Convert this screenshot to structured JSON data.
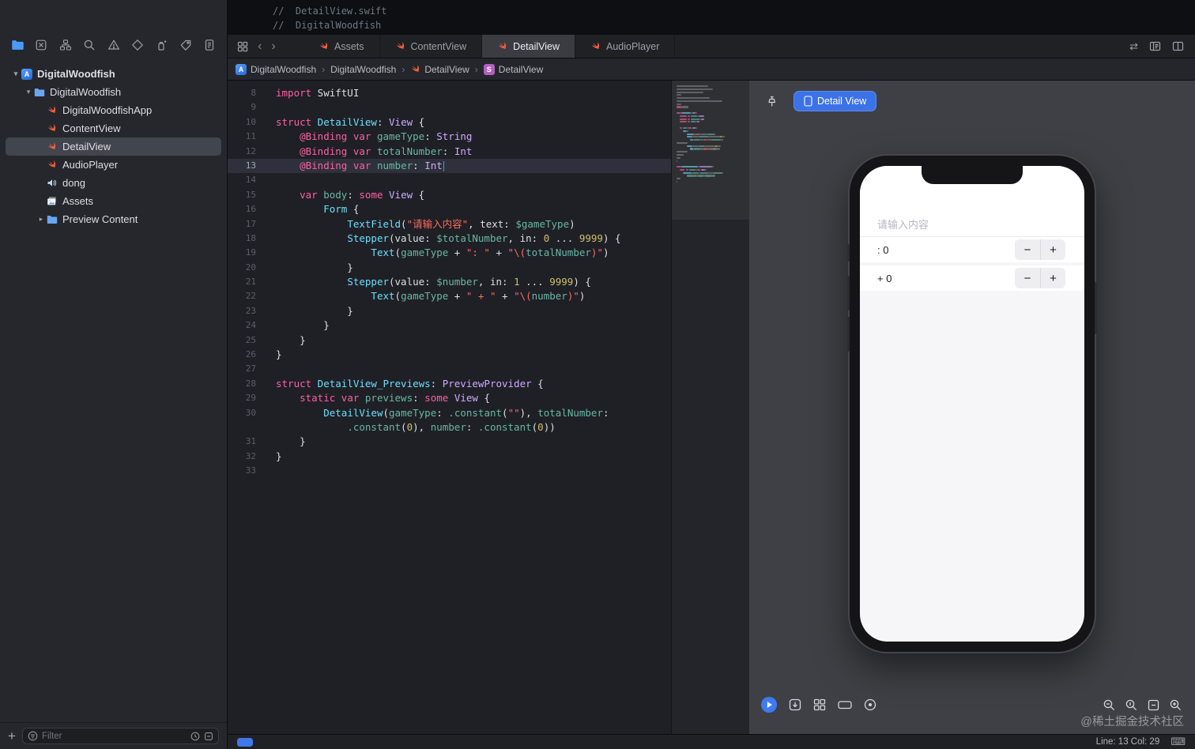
{
  "header_comments": [
    "//  DetailView.swift",
    "//  DigitalWoodfish"
  ],
  "glyphs": {
    "chevron_down": "▾",
    "chevron_right": "▸",
    "back": "‹",
    "forward": "›",
    "crumb_sep": "›",
    "keyboard": "⌨",
    "swap": "⇄"
  },
  "sidebar": {
    "tree": [
      {
        "label": "DigitalWoodfish",
        "icon": "app",
        "level": 0,
        "chevron": "down",
        "bold": true
      },
      {
        "label": "DigitalWoodfish",
        "icon": "folder",
        "level": 1,
        "chevron": "down"
      },
      {
        "label": "DigitalWoodfishApp",
        "icon": "swift",
        "level": 2
      },
      {
        "label": "ContentView",
        "icon": "swift",
        "level": 2
      },
      {
        "label": "DetailView",
        "icon": "swift",
        "level": 2,
        "selected": true
      },
      {
        "label": "AudioPlayer",
        "icon": "swift",
        "level": 2
      },
      {
        "label": "dong",
        "icon": "audio",
        "level": 2
      },
      {
        "label": "Assets",
        "icon": "assets",
        "level": 2
      },
      {
        "label": "Preview Content",
        "icon": "folder",
        "level": 2,
        "chevron": "right"
      }
    ],
    "add_button": "+",
    "filter_placeholder": "Filter"
  },
  "tabs": [
    {
      "label": "Assets"
    },
    {
      "label": "ContentView"
    },
    {
      "label": "DetailView",
      "active": true
    },
    {
      "label": "AudioPlayer"
    }
  ],
  "breadcrumb": [
    {
      "label": "DigitalWoodfish",
      "icon": "app"
    },
    {
      "label": "DigitalWoodfish",
      "icon": "none"
    },
    {
      "label": "DetailView",
      "icon": "swift"
    },
    {
      "label": "DetailView",
      "icon": "sbadge"
    }
  ],
  "editor": {
    "highlight_line": "13",
    "palette": {
      "kw": "#fc5fa3",
      "ty": "#d0a8ff",
      "cy": "#6bdfff",
      "te": "#67b7a4",
      "st": "#fc6a5d",
      "nu": "#d0bf69",
      "pl": "#dfdfe0",
      "cm": "#6c7986"
    },
    "minimap_prefix_widths": [
      40,
      46,
      34,
      6,
      42,
      58,
      6
    ],
    "lines": [
      {
        "n": "8",
        "t": [
          [
            "kw",
            "import"
          ],
          [
            "pl",
            " SwiftUI"
          ]
        ]
      },
      {
        "n": "9",
        "t": []
      },
      {
        "n": "10",
        "t": [
          [
            "kw",
            "struct"
          ],
          [
            "cy",
            " DetailView"
          ],
          [
            "pl",
            ": "
          ],
          [
            "ty",
            "View"
          ],
          [
            "pl",
            " {"
          ]
        ]
      },
      {
        "n": "11",
        "t": [
          [
            "pl",
            "    "
          ],
          [
            "kw",
            "@Binding"
          ],
          [
            "pl",
            " "
          ],
          [
            "kw",
            "var"
          ],
          [
            "pl",
            " "
          ],
          [
            "te",
            "gameType"
          ],
          [
            "pl",
            ": "
          ],
          [
            "ty",
            "String"
          ]
        ]
      },
      {
        "n": "12",
        "t": [
          [
            "pl",
            "    "
          ],
          [
            "kw",
            "@Binding"
          ],
          [
            "pl",
            " "
          ],
          [
            "kw",
            "var"
          ],
          [
            "pl",
            " "
          ],
          [
            "te",
            "totalNumber"
          ],
          [
            "pl",
            ": "
          ],
          [
            "ty",
            "Int"
          ]
        ]
      },
      {
        "n": "13",
        "t": [
          [
            "pl",
            "    "
          ],
          [
            "kw",
            "@Binding"
          ],
          [
            "pl",
            " "
          ],
          [
            "kw",
            "var"
          ],
          [
            "pl",
            " "
          ],
          [
            "te",
            "number"
          ],
          [
            "pl",
            ": "
          ],
          [
            "ty",
            "Int"
          ]
        ]
      },
      {
        "n": "14",
        "t": []
      },
      {
        "n": "15",
        "t": [
          [
            "pl",
            "    "
          ],
          [
            "kw",
            "var"
          ],
          [
            "pl",
            " "
          ],
          [
            "te",
            "body"
          ],
          [
            "pl",
            ": "
          ],
          [
            "kw",
            "some"
          ],
          [
            "pl",
            " "
          ],
          [
            "ty",
            "View"
          ],
          [
            "pl",
            " {"
          ]
        ]
      },
      {
        "n": "16",
        "t": [
          [
            "pl",
            "        "
          ],
          [
            "cy",
            "Form"
          ],
          [
            "pl",
            " {"
          ]
        ]
      },
      {
        "n": "17",
        "t": [
          [
            "pl",
            "            "
          ],
          [
            "cy",
            "TextField"
          ],
          [
            "pl",
            "("
          ],
          [
            "st",
            "\"请输入内容\""
          ],
          [
            "pl",
            ", text: "
          ],
          [
            "te",
            "$gameType"
          ],
          [
            "pl",
            ")"
          ]
        ]
      },
      {
        "n": "18",
        "t": [
          [
            "pl",
            "            "
          ],
          [
            "cy",
            "Stepper"
          ],
          [
            "pl",
            "(value: "
          ],
          [
            "te",
            "$totalNumber"
          ],
          [
            "pl",
            ", in: "
          ],
          [
            "nu",
            "0"
          ],
          [
            "pl",
            " ... "
          ],
          [
            "nu",
            "9999"
          ],
          [
            "pl",
            ") {"
          ]
        ]
      },
      {
        "n": "19",
        "t": [
          [
            "pl",
            "                "
          ],
          [
            "cy",
            "Text"
          ],
          [
            "pl",
            "("
          ],
          [
            "te",
            "gameType"
          ],
          [
            "pl",
            " + "
          ],
          [
            "st",
            "\": \""
          ],
          [
            "pl",
            " + "
          ],
          [
            "st",
            "\"\\("
          ],
          [
            "te",
            "totalNumber"
          ],
          [
            "st",
            ")\""
          ],
          [
            "pl",
            ")"
          ]
        ]
      },
      {
        "n": "20",
        "t": [
          [
            "pl",
            "            }"
          ]
        ]
      },
      {
        "n": "21",
        "t": [
          [
            "pl",
            "            "
          ],
          [
            "cy",
            "Stepper"
          ],
          [
            "pl",
            "(value: "
          ],
          [
            "te",
            "$number"
          ],
          [
            "pl",
            ", in: "
          ],
          [
            "nu",
            "1"
          ],
          [
            "pl",
            " ... "
          ],
          [
            "nu",
            "9999"
          ],
          [
            "pl",
            ") {"
          ]
        ]
      },
      {
        "n": "22",
        "t": [
          [
            "pl",
            "                "
          ],
          [
            "cy",
            "Text"
          ],
          [
            "pl",
            "("
          ],
          [
            "te",
            "gameType"
          ],
          [
            "pl",
            " + "
          ],
          [
            "st",
            "\" + \""
          ],
          [
            "pl",
            " + "
          ],
          [
            "st",
            "\"\\("
          ],
          [
            "te",
            "number"
          ],
          [
            "st",
            ")\""
          ],
          [
            "pl",
            ")"
          ]
        ]
      },
      {
        "n": "23",
        "t": [
          [
            "pl",
            "            }"
          ]
        ]
      },
      {
        "n": "24",
        "t": [
          [
            "pl",
            "        }"
          ]
        ]
      },
      {
        "n": "25",
        "t": [
          [
            "pl",
            "    }"
          ]
        ]
      },
      {
        "n": "26",
        "t": [
          [
            "pl",
            "}"
          ]
        ]
      },
      {
        "n": "27",
        "t": []
      },
      {
        "n": "28",
        "t": [
          [
            "kw",
            "struct"
          ],
          [
            "cy",
            " DetailView_Previews"
          ],
          [
            "pl",
            ": "
          ],
          [
            "ty",
            "PreviewProvider"
          ],
          [
            "pl",
            " {"
          ]
        ]
      },
      {
        "n": "29",
        "t": [
          [
            "pl",
            "    "
          ],
          [
            "kw",
            "static"
          ],
          [
            "pl",
            " "
          ],
          [
            "kw",
            "var"
          ],
          [
            "pl",
            " "
          ],
          [
            "te",
            "previews"
          ],
          [
            "pl",
            ": "
          ],
          [
            "kw",
            "some"
          ],
          [
            "pl",
            " "
          ],
          [
            "ty",
            "View"
          ],
          [
            "pl",
            " {"
          ]
        ]
      },
      {
        "n": "30",
        "t": [
          [
            "pl",
            "        "
          ],
          [
            "cy",
            "DetailView"
          ],
          [
            "pl",
            "("
          ],
          [
            "te",
            "gameType"
          ],
          [
            "pl",
            ": "
          ],
          [
            "te",
            ".constant"
          ],
          [
            "pl",
            "("
          ],
          [
            "st",
            "\"\""
          ],
          [
            "pl",
            "), "
          ],
          [
            "te",
            "totalNumber"
          ],
          [
            "pl",
            ":"
          ]
        ]
      },
      {
        "n": "",
        "t": [
          [
            "pl",
            "            "
          ],
          [
            "te",
            ".constant"
          ],
          [
            "pl",
            "("
          ],
          [
            "nu",
            "0"
          ],
          [
            "pl",
            "), "
          ],
          [
            "te",
            "number"
          ],
          [
            "pl",
            ": "
          ],
          [
            "te",
            ".constant"
          ],
          [
            "pl",
            "("
          ],
          [
            "nu",
            "0"
          ],
          [
            "pl",
            "))"
          ]
        ]
      },
      {
        "n": "31",
        "t": [
          [
            "pl",
            "    }"
          ]
        ]
      },
      {
        "n": "32",
        "t": [
          [
            "pl",
            "}"
          ]
        ]
      },
      {
        "n": "33",
        "t": []
      }
    ]
  },
  "preview": {
    "button_label": "Detail View",
    "phone": {
      "textfield_placeholder": "请输入内容",
      "rows": [
        {
          "label": ": 0"
        },
        {
          "label": "+ 0"
        }
      ],
      "stepper_minus": "−",
      "stepper_plus": "+"
    },
    "watermark": "@稀土掘金技术社区"
  },
  "statusbar": {
    "line_col": "Line: 13  Col: 29"
  }
}
